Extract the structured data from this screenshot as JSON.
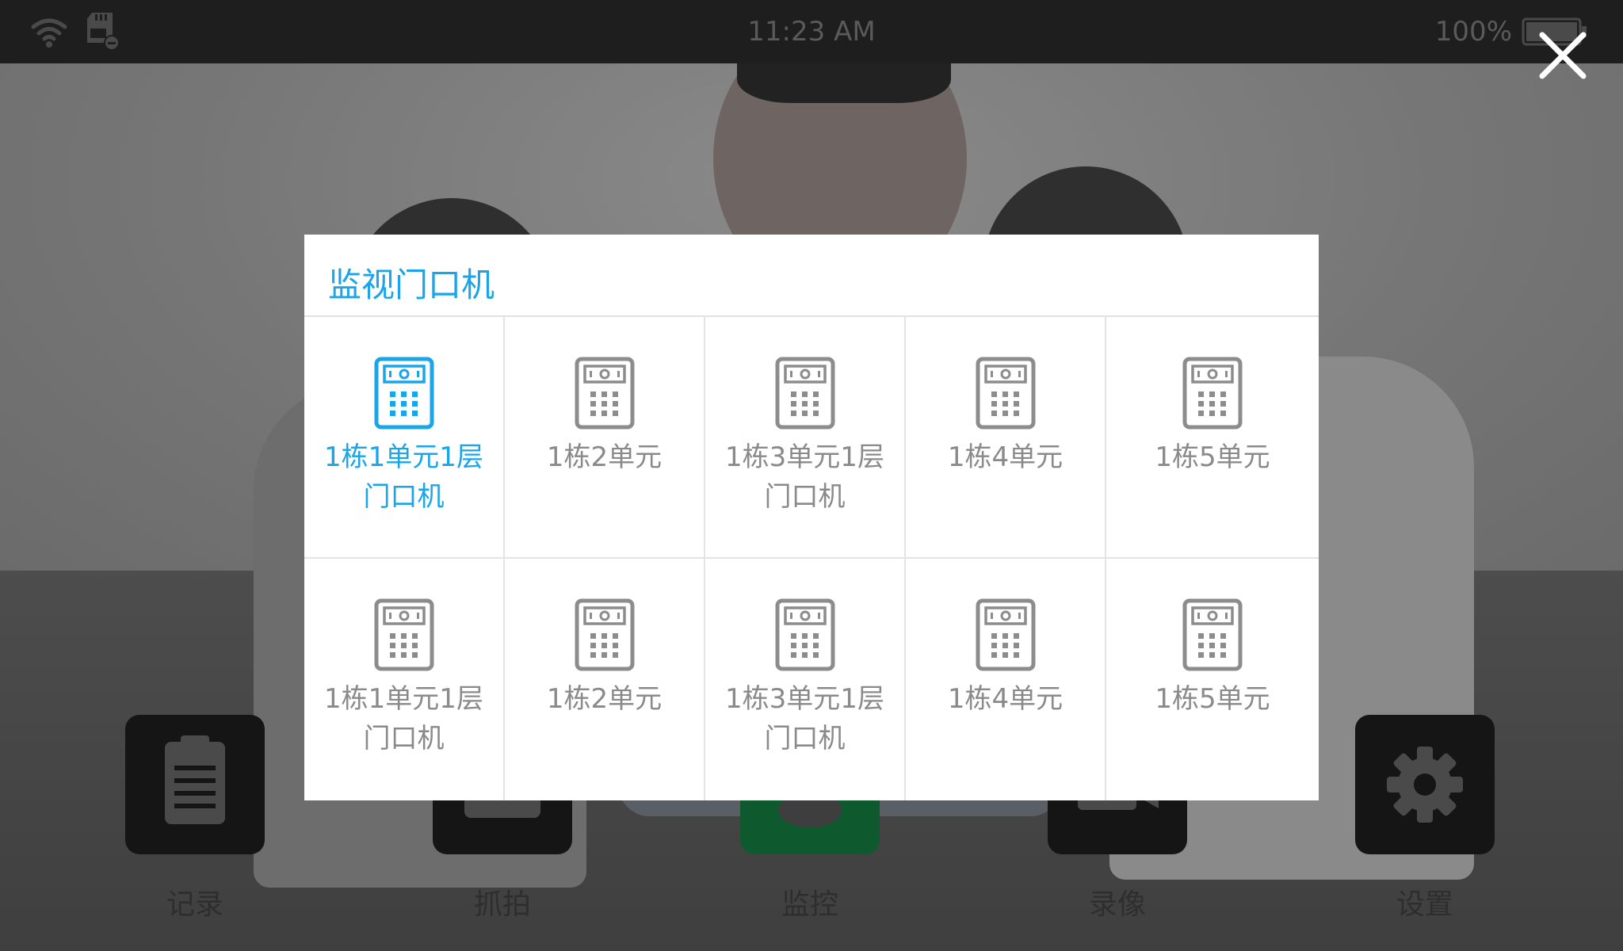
{
  "status_bar": {
    "time": "11:23 AM",
    "battery_text": "100%",
    "icons": [
      "wifi-icon",
      "sd-card-icon",
      "battery-icon"
    ]
  },
  "close_icon": "close-icon",
  "dialog": {
    "title": "监视门口机",
    "items": [
      {
        "line1": "1栋1单元1层",
        "line2": "门口机",
        "selected": true
      },
      {
        "line1": "1栋2单元",
        "line2": "",
        "selected": false
      },
      {
        "line1": "1栋3单元1层",
        "line2": "门口机",
        "selected": false
      },
      {
        "line1": "1栋4单元",
        "line2": "",
        "selected": false
      },
      {
        "line1": "1栋5单元",
        "line2": "",
        "selected": false
      },
      {
        "line1": "1栋1单元1层",
        "line2": "门口机",
        "selected": false
      },
      {
        "line1": "1栋2单元",
        "line2": "",
        "selected": false
      },
      {
        "line1": "1栋3单元1层",
        "line2": "门口机",
        "selected": false
      },
      {
        "line1": "1栋4单元",
        "line2": "",
        "selected": false
      },
      {
        "line1": "1栋5单元",
        "line2": "",
        "selected": false
      }
    ]
  },
  "app_bar": {
    "items": [
      {
        "label": "记录",
        "icon": "clipboard-icon"
      },
      {
        "label": "抓拍",
        "icon": "camera-icon"
      },
      {
        "label": "监控",
        "icon": "monitor-icon",
        "active": true
      },
      {
        "label": "录像",
        "icon": "video-camera-icon"
      },
      {
        "label": "设置",
        "icon": "gear-icon"
      }
    ]
  },
  "colors": {
    "accent": "#1aa5e8",
    "inactive_text": "#8a8a8a",
    "status_bar": "#1e1e1e"
  }
}
